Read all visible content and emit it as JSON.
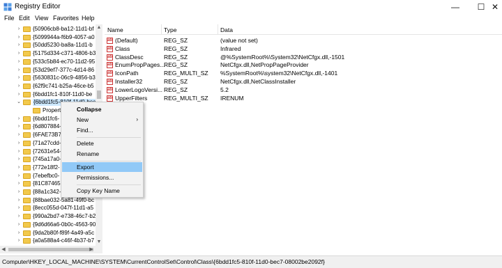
{
  "window": {
    "title": "Registry Editor",
    "minimize": "—",
    "maximize": "☐",
    "close": "✕"
  },
  "menu": [
    "File",
    "Edit",
    "View",
    "Favorites",
    "Help"
  ],
  "tree": {
    "rows": [
      {
        "label": "{50906cb8-ba12-11d1-bf",
        "expander": "›"
      },
      {
        "label": "{5099944a-f6b9-4057-a0",
        "expander": "›"
      },
      {
        "label": "{50dd5230-ba8a-11d1-b",
        "expander": "›"
      },
      {
        "label": "{5175d334-c371-4806-b3",
        "expander": "›"
      },
      {
        "label": "{533c5b84-ec70-11d2-95",
        "expander": "›"
      },
      {
        "label": "{53d29ef7-377c-4d14-86",
        "expander": "›"
      },
      {
        "label": "{5630831c-06c9-4856-b3",
        "expander": "›"
      },
      {
        "label": "{62f9c741-b25a-46ce-b5",
        "expander": "›"
      },
      {
        "label": "{6bdd1fc1-810f-11d0-be",
        "expander": "›"
      },
      {
        "label": "{6bdd1fc5-810f-11d0-bec",
        "expander": "⌄",
        "selected": true
      },
      {
        "label": "Propert",
        "expander": "",
        "child": true
      },
      {
        "label": "{6bdd1fc6-",
        "expander": "›"
      },
      {
        "label": "{6d807884-",
        "expander": "›"
      },
      {
        "label": "{6FAE73B7-",
        "expander": "›"
      },
      {
        "label": "{71a27cdd-",
        "expander": "›"
      },
      {
        "label": "{72631e54-",
        "expander": "›"
      },
      {
        "label": "{745a17a0-",
        "expander": "›"
      },
      {
        "label": "{772e18f2-",
        "expander": "›"
      },
      {
        "label": "{7ebefbc0-",
        "expander": "›"
      },
      {
        "label": "{81C87465-",
        "expander": "›"
      },
      {
        "label": "{88a1c342-4539-11d3-bc",
        "expander": "›"
      },
      {
        "label": "{88bae032-5a81-49f0-bc",
        "expander": "›"
      },
      {
        "label": "{8ecc055d-047f-11d1-a5",
        "expander": "›"
      },
      {
        "label": "{990a2bd7-e738-46c7-b2",
        "expander": "›"
      },
      {
        "label": "{9d6d66a6-0b0c-4563-90",
        "expander": "›"
      },
      {
        "label": "{9da2b80f-f89f-4a49-a5c",
        "expander": "›"
      },
      {
        "label": "{a0a588a4-c46f-4b37-b7",
        "expander": "›"
      }
    ]
  },
  "list": {
    "headers": {
      "name": "Name",
      "type": "Type",
      "data": "Data"
    },
    "rows": [
      {
        "icon": "ab",
        "name": "(Default)",
        "type": "REG_SZ",
        "data": "(value not set)"
      },
      {
        "icon": "ab",
        "name": "Class",
        "type": "REG_SZ",
        "data": "Infrared"
      },
      {
        "icon": "ab",
        "name": "ClassDesc",
        "type": "REG_SZ",
        "data": "@%SystemRoot%\\System32\\NetCfgx.dll,-1501"
      },
      {
        "icon": "ab",
        "name": "EnumPropPages...",
        "type": "REG_SZ",
        "data": "NetCfgx.dll,NetPropPageProvider"
      },
      {
        "icon": "ab",
        "name": "IconPath",
        "type": "REG_MULTI_SZ",
        "data": "%SystemRoot%\\system32\\NetCfgx.dll,-1401"
      },
      {
        "icon": "ab",
        "name": "Installer32",
        "type": "REG_SZ",
        "data": "NetCfgx.dll,NetClassInstaller"
      },
      {
        "icon": "ab",
        "name": "LowerLogoVersi...",
        "type": "REG_SZ",
        "data": "5.2"
      },
      {
        "icon": "ab",
        "name": "UpperFilters",
        "type": "REG_MULTI_SZ",
        "data": "IRENUM"
      }
    ]
  },
  "context_menu": {
    "collapse": "Collapse",
    "new": "New",
    "find": "Find...",
    "delete": "Delete",
    "rename": "Rename",
    "export": "Export",
    "permissions": "Permissions...",
    "copy_key_name": "Copy Key Name",
    "submenu_arrow": "›"
  },
  "statusbar": {
    "path": "Computer\\HKEY_LOCAL_MACHINE\\SYSTEM\\CurrentControlSet\\Control\\Class\\{6bdd1fc5-810f-11d0-bec7-08002be2092f}"
  },
  "colors": {
    "selection": "#cce8ff",
    "menu_highlight": "#91c9f7",
    "folder": "#f2c94c"
  }
}
